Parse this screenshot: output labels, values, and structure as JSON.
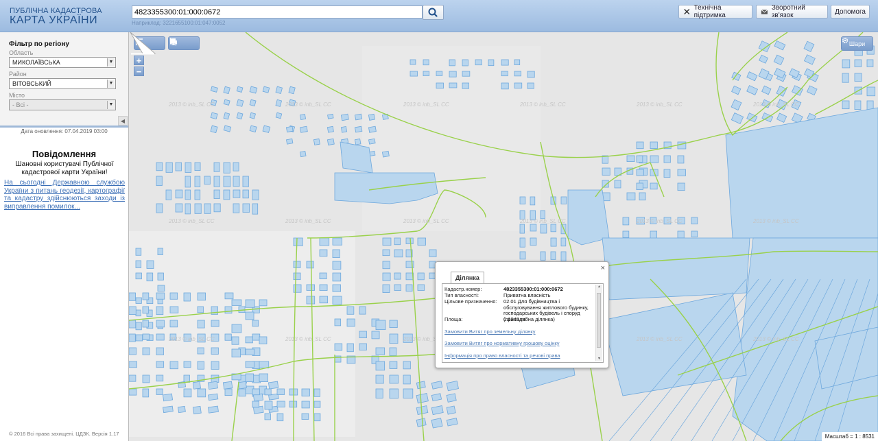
{
  "header": {
    "logo_line1": "ПУБЛІЧНА КАДАСТРОВА",
    "logo_line2": "КАРТА УКРАЇНИ",
    "search_value": "4823355300:01:000:0672",
    "search_hint": "Наприклад: 3221655100:01:047:0052",
    "tech_support": "Технічна підтримка",
    "feedback": "Зворотний зв'язок",
    "help": "Допомога"
  },
  "filter": {
    "title": "Фільтр по регіону",
    "oblast_label": "Область",
    "oblast_value": "МИКОЛАЇВСЬКА",
    "rayon_label": "Район",
    "rayon_value": "ВІТОВСЬКИЙ",
    "misto_label": "Місто",
    "misto_value": "- Всі -"
  },
  "sidebar": {
    "update_date": "Дата оновлення: 07.04.2019 03:00",
    "notice_title": "Повідомлення",
    "notice_body": "Шановні користувачі Публічної кадастрової карти України!",
    "notice_link": "На сьогодні Державною службою України з питань геодезії, картографії та кадастру здійснюються заходи із виправлення помилок...",
    "copyright": "© 2016 Всі права захищені. ЦДЗК. Версія 1.17"
  },
  "map": {
    "layers_label": "Шари",
    "zoom_in": "+",
    "zoom_out": "−",
    "scale_text": "Масштаб = 1 : 8531",
    "watermark": "2013 © inb_SL CC",
    "colors": {
      "parcel_fill": "#b9d6ee",
      "parcel_stroke": "#6ea8dd",
      "boundary": "#9ad14b",
      "background": "#e6e6e6"
    }
  },
  "popup": {
    "tab": "Ділянка",
    "close": "×",
    "rows": [
      {
        "label": "Кадастр.номер:",
        "value": "4823355300:01:000:0672"
      },
      {
        "label": "Тип власності:",
        "value": "Приватна власність"
      },
      {
        "label": "Цільове призначення:",
        "value": "02.01 Для будівництва і обслуговування житлового будинку, господарських будівель і споруд (присадибна ділянка)"
      },
      {
        "label": "Площа:",
        "value": "0.1349 га"
      }
    ],
    "links": [
      "Замовити Витяг про земельну ділянку",
      "Замовити Витяг про нормативну грошову оцінку",
      "Інформація про право власності та речові права"
    ]
  }
}
